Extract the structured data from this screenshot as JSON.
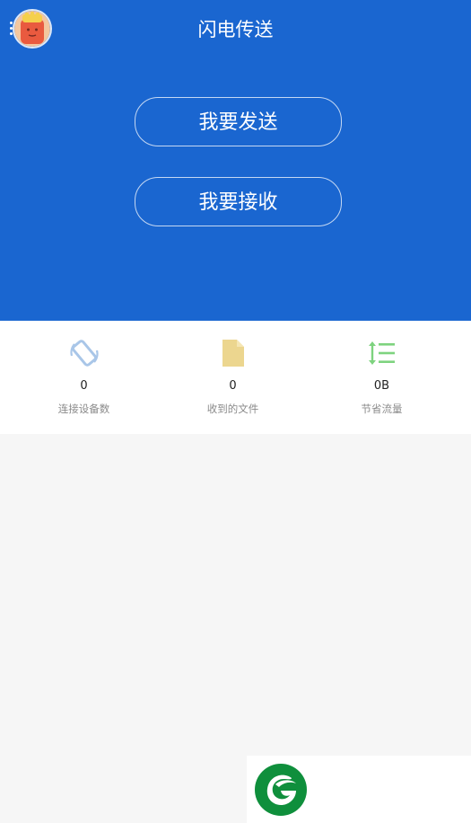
{
  "header": {
    "title": "闪电传送",
    "menu_icon": "more-vert-icon",
    "avatar_icon": "avatar-icon",
    "background_color": "#1a66d0"
  },
  "actions": {
    "send_label": "我要发送",
    "receive_label": "我要接收"
  },
  "stats": [
    {
      "icon": "screen-rotation-icon",
      "value": "0",
      "label": "连接设备数",
      "color": "#a9c6e8"
    },
    {
      "icon": "file-icon",
      "value": "0",
      "label": "收到的文件",
      "color": "#ecd68f"
    },
    {
      "icon": "line-spacing-icon",
      "value": "0B",
      "label": "节省流量",
      "color": "#7ed37f"
    }
  ],
  "corner_logo": {
    "icon": "app-logo-icon",
    "color": "#0f8f3c"
  }
}
